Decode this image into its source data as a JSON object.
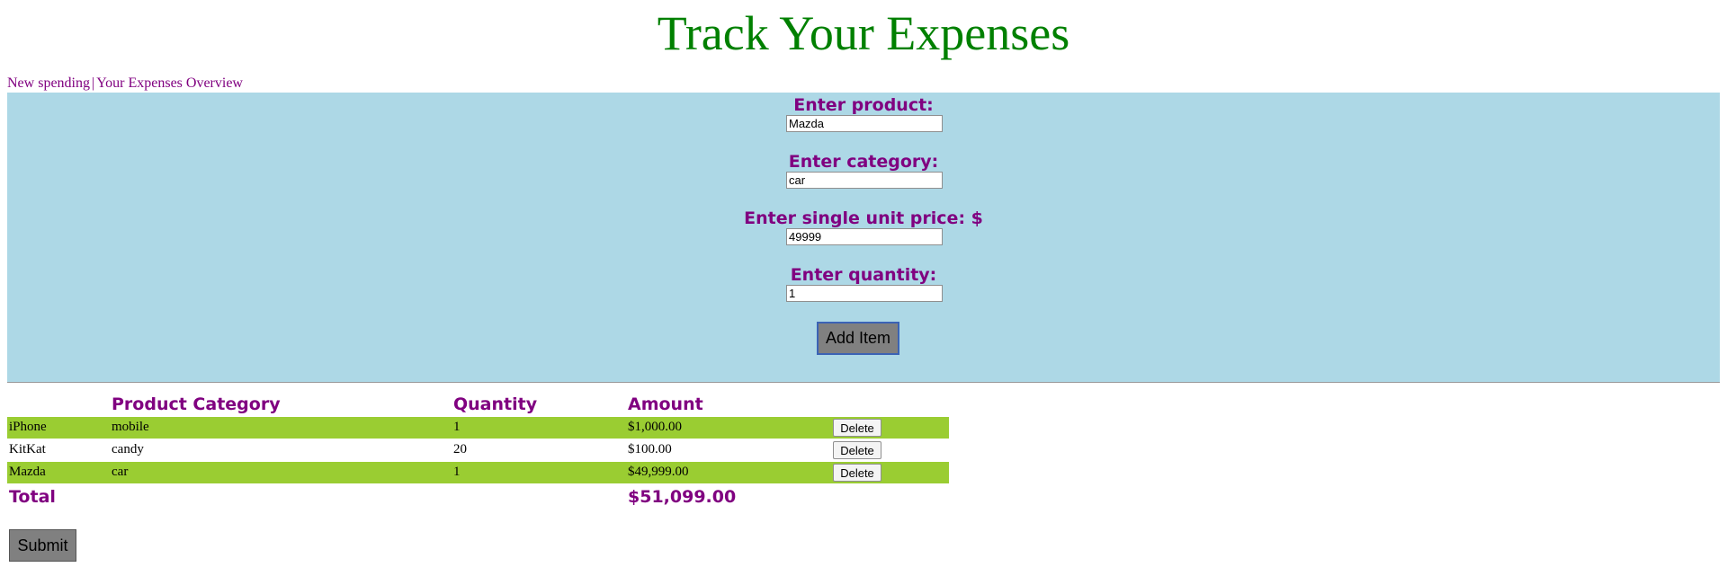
{
  "page": {
    "title": "Track Your Expenses",
    "title_color": "#008000",
    "accent_color": "#800080",
    "panel_color": "#add8e6",
    "row_highlight_color": "#9acd32"
  },
  "nav": {
    "new_spending": "New spending",
    "separator": "|",
    "overview": "Your Expenses Overview"
  },
  "form": {
    "product_label": "Enter product:",
    "product_value": "Mazda",
    "category_label": "Enter category:",
    "category_value": "car",
    "price_label": "Enter single unit price: $",
    "price_value": "49999",
    "quantity_label": "Enter quantity:",
    "quantity_value": "1",
    "add_button": "Add Item"
  },
  "table": {
    "headers": {
      "category": "Product Category",
      "quantity": "Quantity",
      "amount": "Amount"
    },
    "rows": [
      {
        "product": "iPhone",
        "category": "mobile",
        "quantity": "1",
        "amount": "$1,000.00",
        "delete": "Delete"
      },
      {
        "product": "KitKat",
        "category": "candy",
        "quantity": "20",
        "amount": "$100.00",
        "delete": "Delete"
      },
      {
        "product": "Mazda",
        "category": "car",
        "quantity": "1",
        "amount": "$49,999.00",
        "delete": "Delete"
      }
    ],
    "total_label": "Total",
    "total_value": "$51,099.00"
  },
  "submit_button": "Submit"
}
